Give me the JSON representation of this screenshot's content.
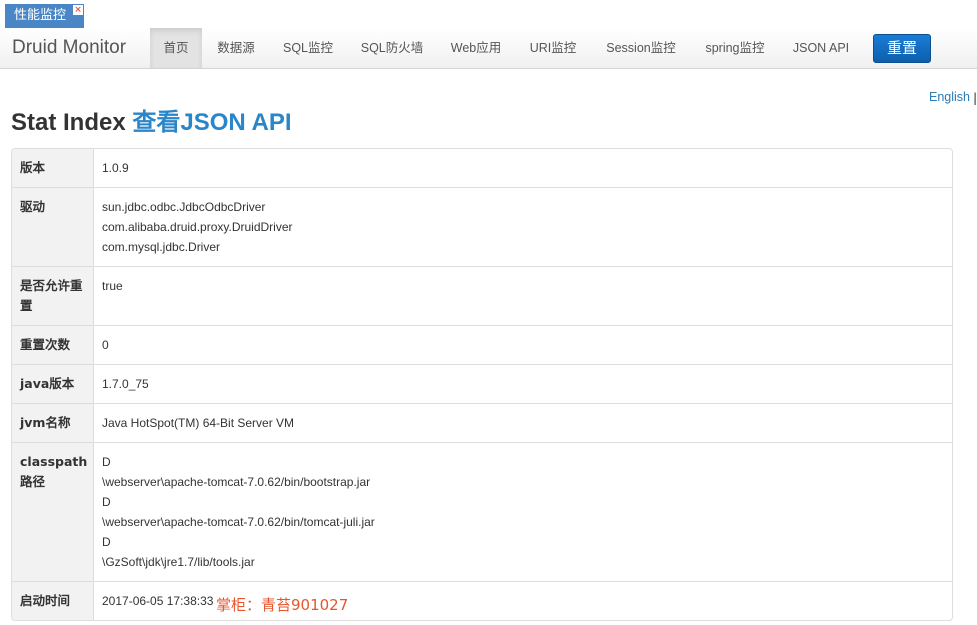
{
  "tabstrip": {
    "tab_label": "性能监控",
    "close_glyph": "×"
  },
  "navbar": {
    "brand": "Druid Monitor",
    "items": [
      "首页",
      "数据源",
      "SQL监控",
      "SQL防火墙",
      "Web应用",
      "URI监控",
      "Session监控",
      "spring监控",
      "JSON API"
    ],
    "active_index": 0,
    "reset_button": "重置"
  },
  "lang": {
    "english": "English",
    "sep": "|"
  },
  "title": {
    "main": "Stat Index",
    "link": "查看JSON API"
  },
  "stats": [
    {
      "label": "版本",
      "values": [
        "1.0.9"
      ]
    },
    {
      "label": "驱动",
      "values": [
        "sun.jdbc.odbc.JdbcOdbcDriver",
        "com.alibaba.druid.proxy.DruidDriver",
        "com.mysql.jdbc.Driver"
      ]
    },
    {
      "label": "是否允许重置",
      "values": [
        "true"
      ]
    },
    {
      "label": "重置次数",
      "values": [
        "0"
      ]
    },
    {
      "label": "java版本",
      "values": [
        "1.7.0_75"
      ]
    },
    {
      "label": "jvm名称",
      "values": [
        "Java HotSpot(TM) 64-Bit Server VM"
      ]
    },
    {
      "label": "classpath路径",
      "values": [
        "D",
        "\\webserver\\apache-tomcat-7.0.62/bin/bootstrap.jar",
        "D",
        "\\webserver\\apache-tomcat-7.0.62/bin/tomcat-juli.jar",
        "D",
        "\\GzSoft\\jdk\\jre1.7/lib/tools.jar"
      ]
    },
    {
      "label": "启动时间",
      "values": [
        "2017-06-05 17:38:33"
      ]
    }
  ],
  "watermark": "掌柜：青苔901027",
  "colors": {
    "accent": "#2a86c8",
    "tab": "#4a86c5",
    "button": "#1a7cd6"
  }
}
